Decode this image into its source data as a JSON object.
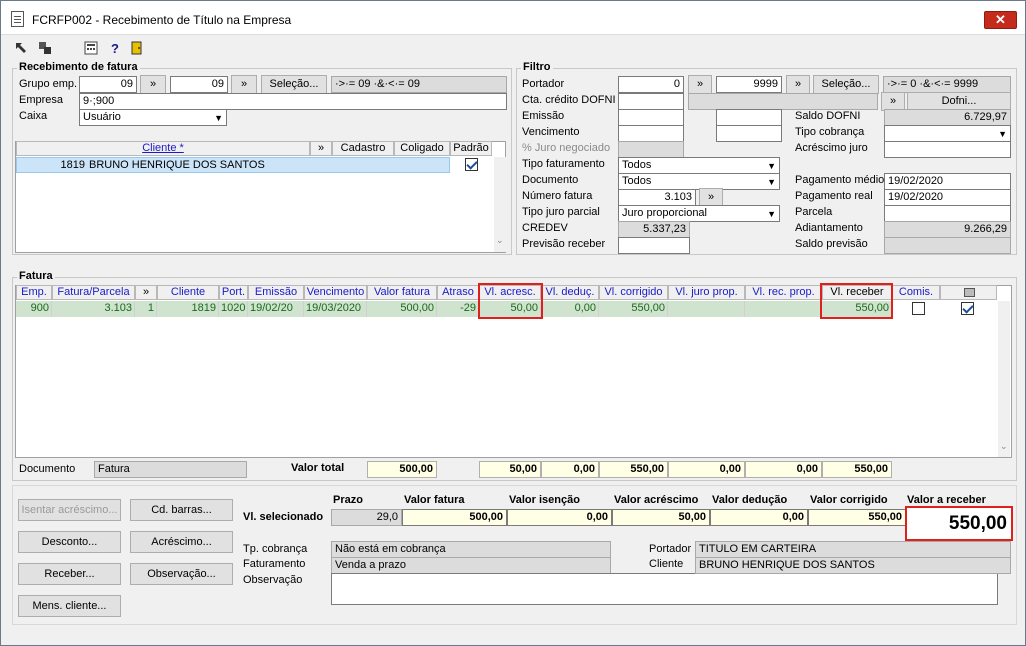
{
  "window": {
    "title": "FCRFP002 - Recebimento de Título na Empresa",
    "close_glyph": "✕"
  },
  "toolbar": {
    "icons": [
      "arrow-left-icon",
      "pages-icon",
      "calculator-icon",
      "help-icon",
      "exit-door-icon"
    ],
    "help_glyph": "?"
  },
  "recebimento": {
    "legend": "Recebimento de fatura",
    "grupo_label": "Grupo emp.",
    "grupo_from": "09",
    "grupo_to": "09",
    "more": "»",
    "selecao": "Seleção...",
    "grupo_range": "·>·= 09 ·&·<·= 09",
    "empresa_label": "Empresa",
    "empresa_value": "9·;900",
    "caixa_label": "Caixa",
    "caixa_value": "Usuário",
    "cols": [
      "Cliente *",
      "»",
      "Cadastro",
      "Coligado",
      "Padrão"
    ],
    "row": {
      "code": "1819",
      "name": "BRUNO HENRIQUE DOS SANTOS"
    }
  },
  "filtro": {
    "legend": "Filtro",
    "portador_label": "Portador",
    "portador_from": "0",
    "portador_to": "9999",
    "selecao": "Seleção...",
    "portador_range": "·>·= 0 ·&·<·= 9999",
    "cta_label": "Cta. crédito DOFNI",
    "dofni_btn": "Dofni...",
    "emissao_label": "Emissão",
    "vencimento_label": "Vencimento",
    "juro_neg_label": "% Juro negociado",
    "tipo_fat_label": "Tipo faturamento",
    "tipo_fat_value": "Todos",
    "documento_label": "Documento",
    "documento_value": "Todos",
    "num_fatura_label": "Número fatura",
    "num_fatura_value": "3.103",
    "tipo_juro_label": "Tipo juro parcial",
    "tipo_juro_value": "Juro proporcional",
    "credev_label": "CREDEV",
    "credev_value": "5.337,23",
    "prev_label": "Previsão receber",
    "saldo_dofni_label": "Saldo DOFNI",
    "saldo_dofni_value": "6.729,97",
    "tipo_cob_label": "Tipo cobrança",
    "acres_juro_label": "Acréscimo juro",
    "pag_medio_label": "Pagamento médio",
    "pag_medio_value": "19/02/2020",
    "pag_real_label": "Pagamento real",
    "pag_real_value": "19/02/2020",
    "parcela_label": "Parcela",
    "adiant_label": "Adiantamento",
    "adiant_value": "9.266,29",
    "saldo_prev_label": "Saldo previsão"
  },
  "fatura": {
    "legend": "Fatura",
    "headers": [
      "Emp.",
      "Fatura/Parcela",
      "»",
      "Cliente",
      "Port.",
      "Emissão",
      "Vencimento",
      "Valor fatura",
      "Atraso",
      "Vl. acresc.",
      "Vl. deduç.",
      "Vl. corrigido",
      "Vl. juro prop.",
      "Vl. rec. prop.",
      "Vl. receber",
      "Comis.",
      ""
    ],
    "row": {
      "emp": "900",
      "fatura": "3.103",
      "parcela": "1",
      "cliente": "1819",
      "port": "1020",
      "emissao": "19/02/20",
      "vencimento": "19/03/2020",
      "valor": "500,00",
      "atraso": "-29",
      "acresc": "50,00",
      "deduc": "0,00",
      "corrigido": "550,00",
      "receber": "550,00"
    },
    "documento_label": "Documento",
    "documento_value": "Fatura",
    "total_label": "Valor total",
    "totals": [
      "500,00",
      "50,00",
      "0,00",
      "550,00",
      "0,00",
      "0,00",
      "550,00"
    ]
  },
  "actions": {
    "isentar": "Isentar acréscimo...",
    "cdbarras": "Cd. barras...",
    "desconto": "Desconto...",
    "acrescimo": "Acréscimo...",
    "receber": "Receber...",
    "observacao": "Observação...",
    "mens": "Mens. cliente..."
  },
  "summary": {
    "headers": [
      "Prazo",
      "Valor fatura",
      "Valor isenção",
      "Valor acréscimo",
      "Valor dedução",
      "Valor corrigido",
      "Valor a receber"
    ],
    "row_label": "Vl. selecionado",
    "values": [
      "29,0",
      "500,00",
      "0,00",
      "50,00",
      "0,00",
      "550,00"
    ],
    "receber_big": "550,00",
    "tp_cob_label": "Tp. cobrança",
    "tp_cob_value": "Não está em cobrança",
    "faturamento_label": "Faturamento",
    "faturamento_value": "Venda a prazo",
    "obs_label": "Observação",
    "portador_label": "Portador",
    "portador_value": "TITULO EM CARTEIRA",
    "cliente_label": "Cliente",
    "cliente_value": "BRUNO HENRIQUE DOS SANTOS"
  }
}
